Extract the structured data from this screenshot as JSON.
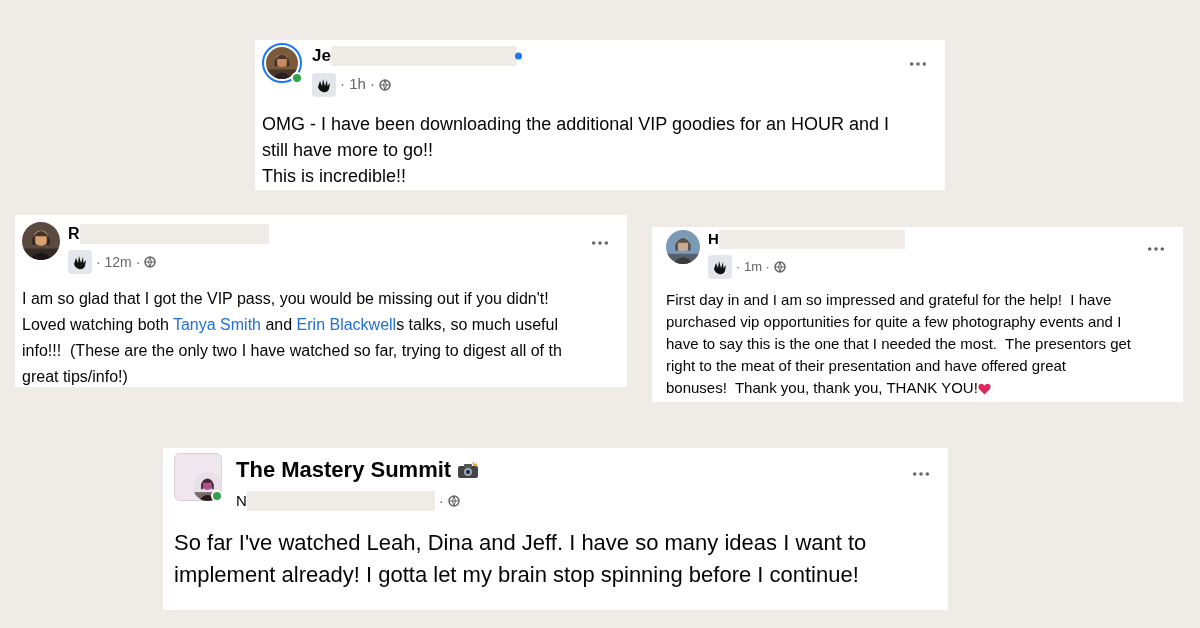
{
  "posts": [
    {
      "kind": "member",
      "author": "Je",
      "verified": true,
      "story_ring": true,
      "online": true,
      "time": "· 1h ·",
      "body": [
        {
          "kind": "text",
          "text": "OMG - I have been downloading the additional VIP goodies for an HOUR and I\nstill have more to go!!\nThis is incredible!!"
        }
      ]
    },
    {
      "kind": "member",
      "author": "R",
      "verified": false,
      "story_ring": false,
      "online": false,
      "time": "· 12m ·",
      "body": [
        {
          "kind": "text",
          "text": "I am so glad that I got the VIP pass, you would be missing out if you didn't!\nLoved watching both "
        },
        {
          "kind": "link",
          "text": "Tanya Smith"
        },
        {
          "kind": "text",
          "text": " and "
        },
        {
          "kind": "link",
          "text": "Erin Blackwell"
        },
        {
          "kind": "text",
          "text": "s talks, so much useful\ninfo!!!  (These are the only two I have watched so far, trying to digest all of th\ngreat tips/info!)"
        }
      ]
    },
    {
      "kind": "member",
      "author": "H",
      "verified": false,
      "story_ring": false,
      "online": false,
      "time": "· 1m ·",
      "body": [
        {
          "kind": "text",
          "text": "First day in and I am so impressed and grateful for the help!  I have\npurchased vip opportunities for quite a few photography events and I\nhave to say this is the one that I needed the most.  The presentors get\nright to the meat of their presentation and have offered great\nbonuses!  Thank you, thank you, THANK YOU!"
        },
        {
          "kind": "heart"
        }
      ]
    },
    {
      "kind": "group",
      "title": "The Mastery Summit",
      "author": "N",
      "online": true,
      "time": "·",
      "body": [
        {
          "kind": "text",
          "text": "So far I've watched Leah, Dina and Jeff. I have so many ideas I want to\nimplement already! I gotta let my brain stop spinning before I continue!"
        }
      ]
    }
  ]
}
